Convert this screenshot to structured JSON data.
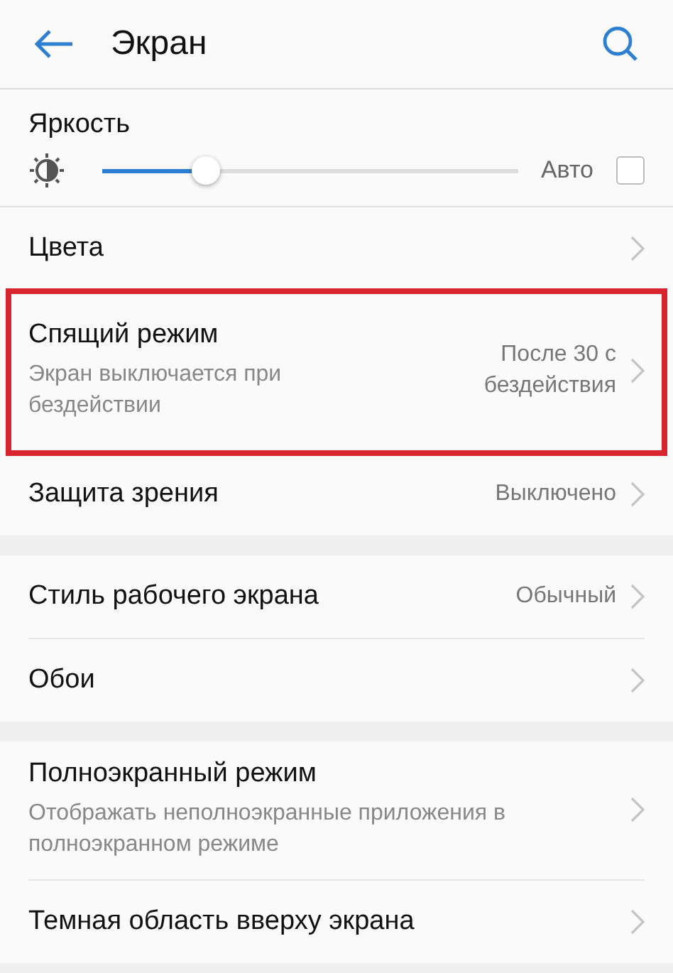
{
  "header": {
    "title": "Экран"
  },
  "brightness": {
    "label": "Яркость",
    "level": 0.25,
    "auto_label": "Авто",
    "auto_checked": false
  },
  "groups": [
    {
      "items": [
        {
          "title": "Цвета",
          "highlighted": false
        },
        {
          "title": "Спящий режим",
          "subtitle": "Экран выключается при бездействии",
          "value": "После 30 с бездействия",
          "highlighted": true
        },
        {
          "title": "Защита зрения",
          "value": "Выключено",
          "highlighted": false
        }
      ]
    },
    {
      "items": [
        {
          "title": "Стиль рабочего экрана",
          "value": "Обычный",
          "highlighted": false
        },
        {
          "title": "Обои",
          "highlighted": false
        }
      ]
    },
    {
      "items": [
        {
          "title": "Полноэкранный режим",
          "subtitle": "Отображать неполноэкранные приложения в полноэкранном режиме",
          "highlighted": false
        },
        {
          "title": "Темная область вверху экрана",
          "highlighted": false
        }
      ]
    }
  ]
}
